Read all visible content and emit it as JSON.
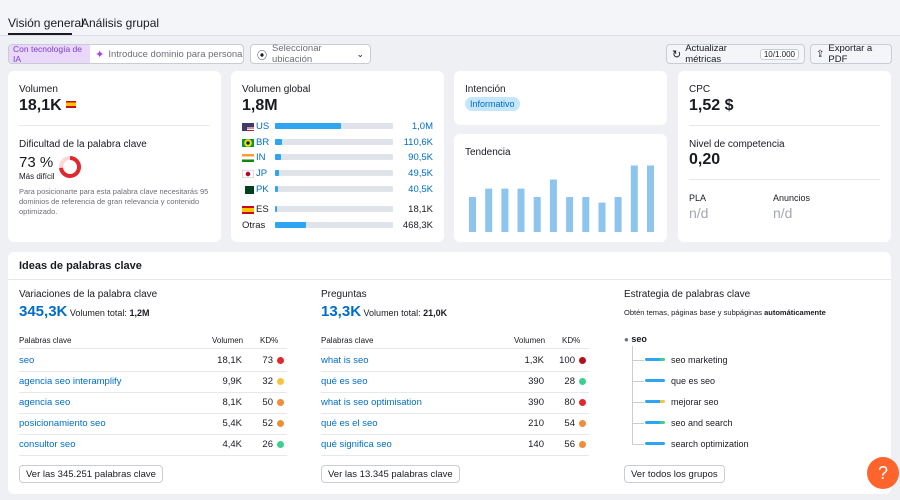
{
  "tabs": [
    "Visión general",
    "Análisis grupal"
  ],
  "toolbar": {
    "ai_label": "Con tecnología de IA",
    "domain_placeholder": "Introduce dominio para personali...",
    "location_placeholder": "Seleccionar ubicación",
    "update_label": "Actualizar métricas",
    "update_count": "10/1.000",
    "export_label": "Exportar a PDF"
  },
  "volume": {
    "label": "Volumen",
    "value": "18,1K"
  },
  "difficulty": {
    "label": "Dificultad de la palabra clave",
    "value": "73 %",
    "level": "Más difícil",
    "percent": 73,
    "description": "Para posicionarte para esta palabra clave necesitarás 95 dominios de referencia de gran relevancia y contenido optimizado."
  },
  "global_volume": {
    "label": "Volumen global",
    "value": "1,8M",
    "countries": [
      {
        "code": "US",
        "value": "1,0M",
        "fraction": 0.56,
        "flag": "us"
      },
      {
        "code": "BR",
        "value": "110,6K",
        "fraction": 0.06,
        "flag": "br"
      },
      {
        "code": "IN",
        "value": "90,5K",
        "fraction": 0.05,
        "flag": "in"
      },
      {
        "code": "JP",
        "value": "49,5K",
        "fraction": 0.03,
        "flag": "jp"
      },
      {
        "code": "PK",
        "value": "40,5K",
        "fraction": 0.025,
        "flag": "pk"
      }
    ],
    "local": {
      "code": "ES",
      "value": "18,1K",
      "fraction": 0.012,
      "flag": "es"
    },
    "others": {
      "label": "Otras",
      "value": "468,3K",
      "fraction": 0.26
    }
  },
  "intent": {
    "label": "Intención",
    "badge": "Informativo"
  },
  "trend": {
    "label": "Tendencia",
    "values": [
      0.5,
      0.62,
      0.62,
      0.62,
      0.5,
      0.75,
      0.5,
      0.5,
      0.42,
      0.5,
      0.95,
      0.95
    ]
  },
  "cpc": {
    "label": "CPC",
    "value": "1,52 $"
  },
  "competition": {
    "label": "Nivel de competencia",
    "value": "0,20"
  },
  "pla": {
    "label": "PLA",
    "value": "n/d"
  },
  "ads": {
    "label": "Anuncios",
    "value": "n/d"
  },
  "ideas": {
    "title": "Ideas de palabras clave",
    "variations": {
      "label": "Variaciones de la palabra clave",
      "count": "345,3K",
      "total_label": "Volumen total:",
      "total_value": "1,2M",
      "col_kw": "Palabras clave",
      "col_vol": "Volumen",
      "col_kd": "KD%",
      "rows": [
        {
          "kw": "seo",
          "vol": "18,1K",
          "kd": "73",
          "color": "#e0282e"
        },
        {
          "kw": "agencia seo interamplify",
          "vol": "9,9K",
          "kd": "32",
          "color": "#f7c342"
        },
        {
          "kw": "agencia seo",
          "vol": "8,1K",
          "kd": "50",
          "color": "#f08c3a"
        },
        {
          "kw": "posicionamiento seo",
          "vol": "5,4K",
          "kd": "52",
          "color": "#f08c3a"
        },
        {
          "kw": "consultor seo",
          "vol": "4,4K",
          "kd": "26",
          "color": "#3ccf8e"
        }
      ],
      "button": "Ver las 345.251 palabras clave"
    },
    "questions": {
      "label": "Preguntas",
      "count": "13,3K",
      "total_label": "Volumen total:",
      "total_value": "21,0K",
      "col_kw": "Palabras clave",
      "col_vol": "Volumen",
      "col_kd": "KD%",
      "rows": [
        {
          "kw": "what is seo",
          "vol": "1,3K",
          "kd": "100",
          "color": "#b80f1c"
        },
        {
          "kw": "qué es seo",
          "vol": "390",
          "kd": "28",
          "color": "#3ccf8e"
        },
        {
          "kw": "what is seo optimisation",
          "vol": "390",
          "kd": "80",
          "color": "#e0282e"
        },
        {
          "kw": "qué es el seo",
          "vol": "210",
          "kd": "54",
          "color": "#f08c3a"
        },
        {
          "kw": "qué significa seo",
          "vol": "140",
          "kd": "56",
          "color": "#f08c3a"
        }
      ],
      "button": "Ver las 13.345 palabras clave"
    },
    "strategy": {
      "label": "Estrategia de palabras clave",
      "desc_prefix": "Obtén temas, páginas base y subpáginas ",
      "desc_bold": "automáticamente",
      "root": "seo",
      "children": [
        "seo marketing",
        "que es seo",
        "mejorar seo",
        "seo and search",
        "search optimization"
      ],
      "button": "Ver todos los grupos"
    }
  },
  "help": "?"
}
